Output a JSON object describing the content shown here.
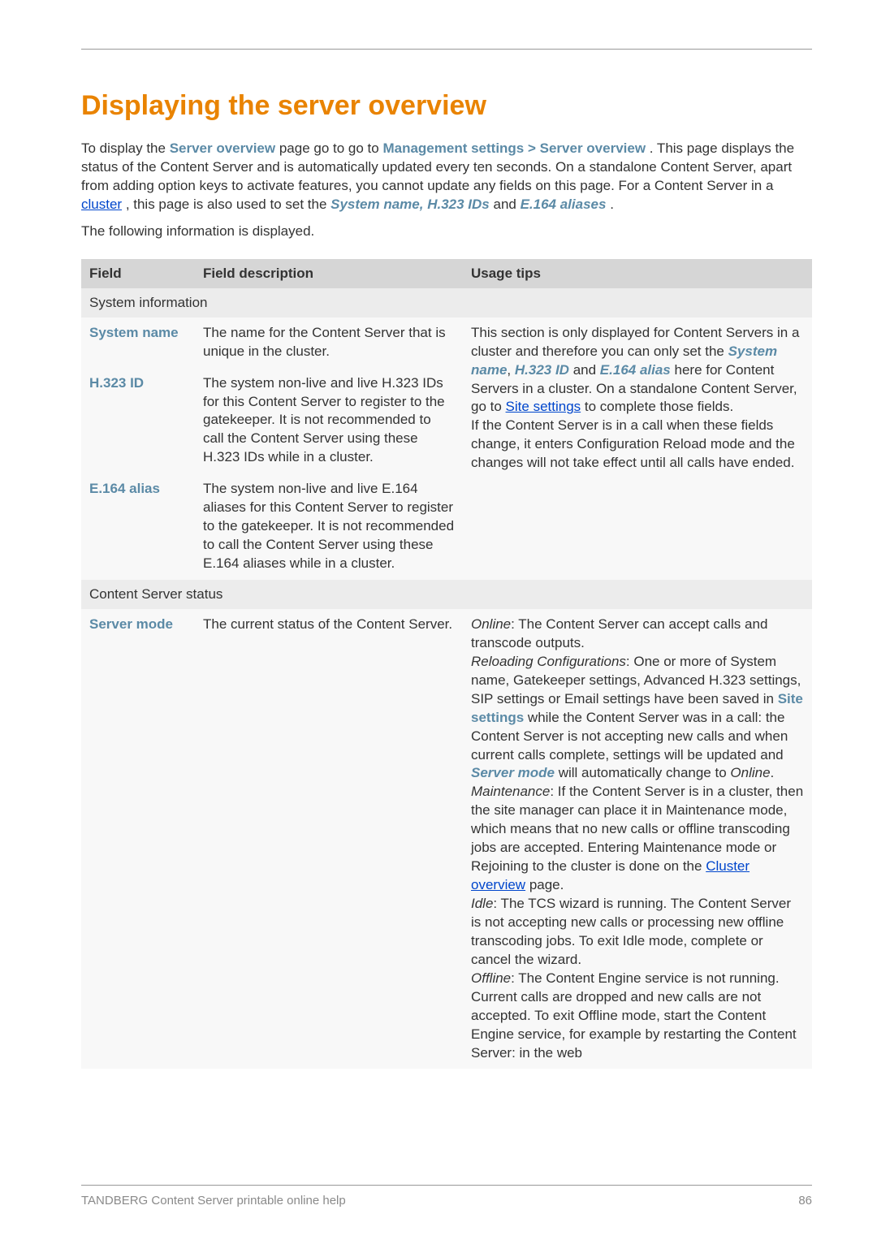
{
  "heading": "Displaying the server overview",
  "intro": {
    "pre1": "To display the ",
    "so1": "Server overview",
    "mid1": " page go to go to ",
    "mgmt": "Management settings > Server overview",
    "post1": " . This page displays the status of the Content Server and is automatically updated every ten seconds. On a standalone Content Server, apart from adding option keys to activate features, you cannot update any fields on this page. For a Content Server in a ",
    "cluster": "cluster",
    "post2": ", this page is also used to set the ",
    "sysname": "System name, H.323 IDs",
    "and": " and ",
    "e164": "E.164 aliases",
    "period": "."
  },
  "after_intro": "The following information is displayed.",
  "headers": {
    "field": "Field",
    "desc": "Field description",
    "usage": "Usage tips"
  },
  "sections": {
    "sysinfo": "System information",
    "css": "Content Server status"
  },
  "rows": {
    "system_name": {
      "label": "System name",
      "desc": "The name for the Content Server that is unique in the cluster."
    },
    "h323": {
      "label": "H.323 ID",
      "desc": "The system non-live and live H.323 IDs for this Content Server to register to the gatekeeper. It is not recommended to call the Content Server using these H.323 IDs while in a cluster."
    },
    "e164": {
      "label": "E.164 alias",
      "desc": "The system non-live and live E.164 aliases for this Content Server to register to the gatekeeper. It is not recommended to call the Content Server using these E.164 aliases while in a cluster."
    },
    "server_mode": {
      "label": "Server mode",
      "desc": "The current status of the Content Server."
    }
  },
  "usage_sys": {
    "p1": "This section is only displayed for Content Servers in a cluster and therefore you can only set the ",
    "sn": "System name",
    "c1": ", ",
    "h323": "H.323 ID",
    "and1": " and ",
    "e164": "E.164 alias",
    "p2": " here for Content Servers in a cluster. On a standalone Content Server, go to ",
    "sitesettings": "Site settings",
    "p3": " to complete those fields.",
    "p4": "If the Content Server is in a call when these fields change, it enters Configuration Reload mode and the changes will not take effect until all calls have ended."
  },
  "usage_mode": {
    "online_label": "Online",
    "online_text": ": The Content Server can accept calls and transcode outputs.",
    "reload_label": "Reloading Configurations",
    "reload_text1": ": One or more of System name, Gatekeeper settings, Advanced H.323 settings, SIP settings or Email settings have been saved in ",
    "site_settings": "Site settings",
    "reload_text2": " while the Content Server was in a call: the Content Server is not accepting new calls and when current calls complete, settings will be updated and ",
    "server_mode": "Server mode",
    "reload_text3": " will automatically change to ",
    "online2": "Online",
    "period1": ".",
    "maint_label": "Maintenance",
    "maint_text1": ": If the Content Server is in a cluster, then the site manager can place it in Maintenance mode, which means that no new calls or offline transcoding jobs are accepted. Entering Maintenance mode or Rejoining to the cluster is done on the ",
    "cluster_overview": "Cluster overview",
    "maint_text2": " page.",
    "idle_label": "Idle",
    "idle_text": ": The TCS wizard is running. The Content Server is not accepting new calls or processing new offline transcoding jobs. To exit Idle mode, complete or cancel the wizard.",
    "offline_label": "Offline",
    "offline_text": ": The Content Engine service is not running. Current calls are dropped and new calls are not accepted. To exit Offline mode, start the Content Engine service, for example by restarting the Content Server: in the web"
  },
  "footer": {
    "left": "TANDBERG Content Server printable online help",
    "right": "86"
  }
}
